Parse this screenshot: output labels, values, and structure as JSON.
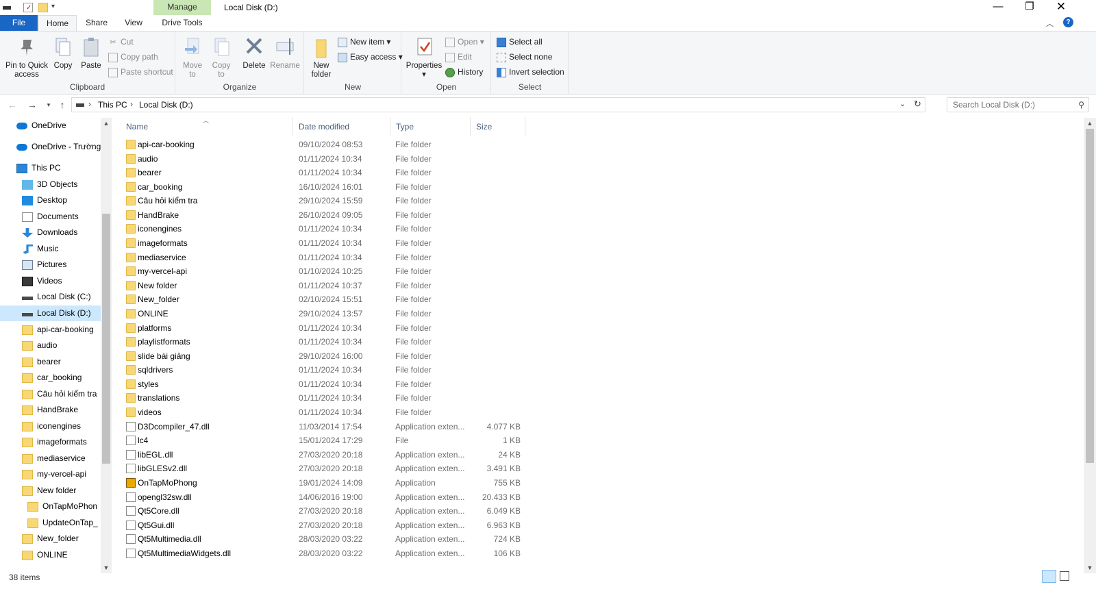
{
  "window": {
    "title": "Local Disk (D:)",
    "context_tab": "Manage"
  },
  "tabs": {
    "file": "File",
    "home": "Home",
    "share": "Share",
    "view": "View",
    "drive_tools": "Drive Tools"
  },
  "ribbon": {
    "clipboard": {
      "label": "Clipboard",
      "pin": "Pin to Quick access",
      "copy": "Copy",
      "paste": "Paste",
      "cut": "Cut",
      "copy_path": "Copy path",
      "paste_shortcut": "Paste shortcut"
    },
    "organize": {
      "label": "Organize",
      "move_to": "Move to",
      "copy_to": "Copy to",
      "delete": "Delete",
      "rename": "Rename"
    },
    "new": {
      "label": "New",
      "new_folder": "New folder",
      "new_item": "New item",
      "easy_access": "Easy access"
    },
    "open": {
      "label": "Open",
      "properties": "Properties",
      "open": "Open",
      "edit": "Edit",
      "history": "History"
    },
    "select": {
      "label": "Select",
      "select_all": "Select all",
      "select_none": "Select none",
      "invert": "Invert selection"
    }
  },
  "address": {
    "crumb1": "This PC",
    "crumb2": "Local Disk (D:)",
    "search_placeholder": "Search Local Disk (D:)"
  },
  "nav": [
    {
      "label": "OneDrive",
      "icon": "cloud-icon"
    },
    {
      "label": "OneDrive - Trường",
      "icon": "cloud-icon"
    },
    {
      "label": "This PC",
      "icon": "pc-icon"
    },
    {
      "label": "3D Objects",
      "icon": "cube-icon"
    },
    {
      "label": "Desktop",
      "icon": "desktop-icon"
    },
    {
      "label": "Documents",
      "icon": "document-icon"
    },
    {
      "label": "Downloads",
      "icon": "download-icon"
    },
    {
      "label": "Music",
      "icon": "music-icon"
    },
    {
      "label": "Pictures",
      "icon": "picture-icon"
    },
    {
      "label": "Videos",
      "icon": "video-icon"
    },
    {
      "label": "Local Disk (C:)",
      "icon": "drive-icon"
    },
    {
      "label": "Local Disk (D:)",
      "icon": "drive-icon"
    },
    {
      "label": "api-car-booking",
      "icon": "folder-icon"
    },
    {
      "label": "audio",
      "icon": "folder-icon"
    },
    {
      "label": "bearer",
      "icon": "folder-icon"
    },
    {
      "label": "car_booking",
      "icon": "folder-icon"
    },
    {
      "label": "Câu hỏi kiểm tra",
      "icon": "folder-icon"
    },
    {
      "label": "HandBrake",
      "icon": "folder-icon"
    },
    {
      "label": "iconengines",
      "icon": "folder-icon"
    },
    {
      "label": "imageformats",
      "icon": "folder-icon"
    },
    {
      "label": "mediaservice",
      "icon": "folder-icon"
    },
    {
      "label": "my-vercel-api",
      "icon": "folder-icon"
    },
    {
      "label": "New folder",
      "icon": "folder-icon"
    },
    {
      "label": "OnTapMoPhon",
      "icon": "folder-icon"
    },
    {
      "label": "UpdateOnTap_",
      "icon": "folder-icon"
    },
    {
      "label": "New_folder",
      "icon": "folder-icon"
    },
    {
      "label": "ONLINE",
      "icon": "folder-icon"
    }
  ],
  "columns": {
    "name": "Name",
    "date": "Date modified",
    "type": "Type",
    "size": "Size"
  },
  "files": [
    {
      "name": "api-car-booking",
      "date": "09/10/2024 08:53",
      "type": "File folder",
      "size": "",
      "kind": "folder"
    },
    {
      "name": "audio",
      "date": "01/11/2024 10:34",
      "type": "File folder",
      "size": "",
      "kind": "folder"
    },
    {
      "name": "bearer",
      "date": "01/11/2024 10:34",
      "type": "File folder",
      "size": "",
      "kind": "folder"
    },
    {
      "name": "car_booking",
      "date": "16/10/2024 16:01",
      "type": "File folder",
      "size": "",
      "kind": "folder"
    },
    {
      "name": "Câu hỏi kiểm tra",
      "date": "29/10/2024 15:59",
      "type": "File folder",
      "size": "",
      "kind": "folder"
    },
    {
      "name": "HandBrake",
      "date": "26/10/2024 09:05",
      "type": "File folder",
      "size": "",
      "kind": "folder"
    },
    {
      "name": "iconengines",
      "date": "01/11/2024 10:34",
      "type": "File folder",
      "size": "",
      "kind": "folder"
    },
    {
      "name": "imageformats",
      "date": "01/11/2024 10:34",
      "type": "File folder",
      "size": "",
      "kind": "folder"
    },
    {
      "name": "mediaservice",
      "date": "01/11/2024 10:34",
      "type": "File folder",
      "size": "",
      "kind": "folder"
    },
    {
      "name": "my-vercel-api",
      "date": "01/10/2024 10:25",
      "type": "File folder",
      "size": "",
      "kind": "folder"
    },
    {
      "name": "New folder",
      "date": "01/11/2024 10:37",
      "type": "File folder",
      "size": "",
      "kind": "folder"
    },
    {
      "name": "New_folder",
      "date": "02/10/2024 15:51",
      "type": "File folder",
      "size": "",
      "kind": "folder"
    },
    {
      "name": "ONLINE",
      "date": "29/10/2024 13:57",
      "type": "File folder",
      "size": "",
      "kind": "folder"
    },
    {
      "name": "platforms",
      "date": "01/11/2024 10:34",
      "type": "File folder",
      "size": "",
      "kind": "folder"
    },
    {
      "name": "playlistformats",
      "date": "01/11/2024 10:34",
      "type": "File folder",
      "size": "",
      "kind": "folder"
    },
    {
      "name": "slide bài giảng",
      "date": "29/10/2024 16:00",
      "type": "File folder",
      "size": "",
      "kind": "folder"
    },
    {
      "name": "sqldrivers",
      "date": "01/11/2024 10:34",
      "type": "File folder",
      "size": "",
      "kind": "folder"
    },
    {
      "name": "styles",
      "date": "01/11/2024 10:34",
      "type": "File folder",
      "size": "",
      "kind": "folder"
    },
    {
      "name": "translations",
      "date": "01/11/2024 10:34",
      "type": "File folder",
      "size": "",
      "kind": "folder"
    },
    {
      "name": "videos",
      "date": "01/11/2024 10:34",
      "type": "File folder",
      "size": "",
      "kind": "folder"
    },
    {
      "name": "D3Dcompiler_47.dll",
      "date": "11/03/2014 17:54",
      "type": "Application exten...",
      "size": "4.077 KB",
      "kind": "dll"
    },
    {
      "name": "lc4",
      "date": "15/01/2024 17:29",
      "type": "File",
      "size": "1 KB",
      "kind": "file"
    },
    {
      "name": "libEGL.dll",
      "date": "27/03/2020 20:18",
      "type": "Application exten...",
      "size": "24 KB",
      "kind": "dll"
    },
    {
      "name": "libGLESv2.dll",
      "date": "27/03/2020 20:18",
      "type": "Application exten...",
      "size": "3.491 KB",
      "kind": "dll"
    },
    {
      "name": "OnTapMoPhong",
      "date": "19/01/2024 14:09",
      "type": "Application",
      "size": "755 KB",
      "kind": "exe"
    },
    {
      "name": "opengl32sw.dll",
      "date": "14/06/2016 19:00",
      "type": "Application exten...",
      "size": "20.433 KB",
      "kind": "dll"
    },
    {
      "name": "Qt5Core.dll",
      "date": "27/03/2020 20:18",
      "type": "Application exten...",
      "size": "6.049 KB",
      "kind": "dll"
    },
    {
      "name": "Qt5Gui.dll",
      "date": "27/03/2020 20:18",
      "type": "Application exten...",
      "size": "6.963 KB",
      "kind": "dll"
    },
    {
      "name": "Qt5Multimedia.dll",
      "date": "28/03/2020 03:22",
      "type": "Application exten...",
      "size": "724 KB",
      "kind": "dll"
    },
    {
      "name": "Qt5MultimediaWidgets.dll",
      "date": "28/03/2020 03:22",
      "type": "Application exten...",
      "size": "106 KB",
      "kind": "dll"
    }
  ],
  "status": {
    "items": "38 items"
  }
}
